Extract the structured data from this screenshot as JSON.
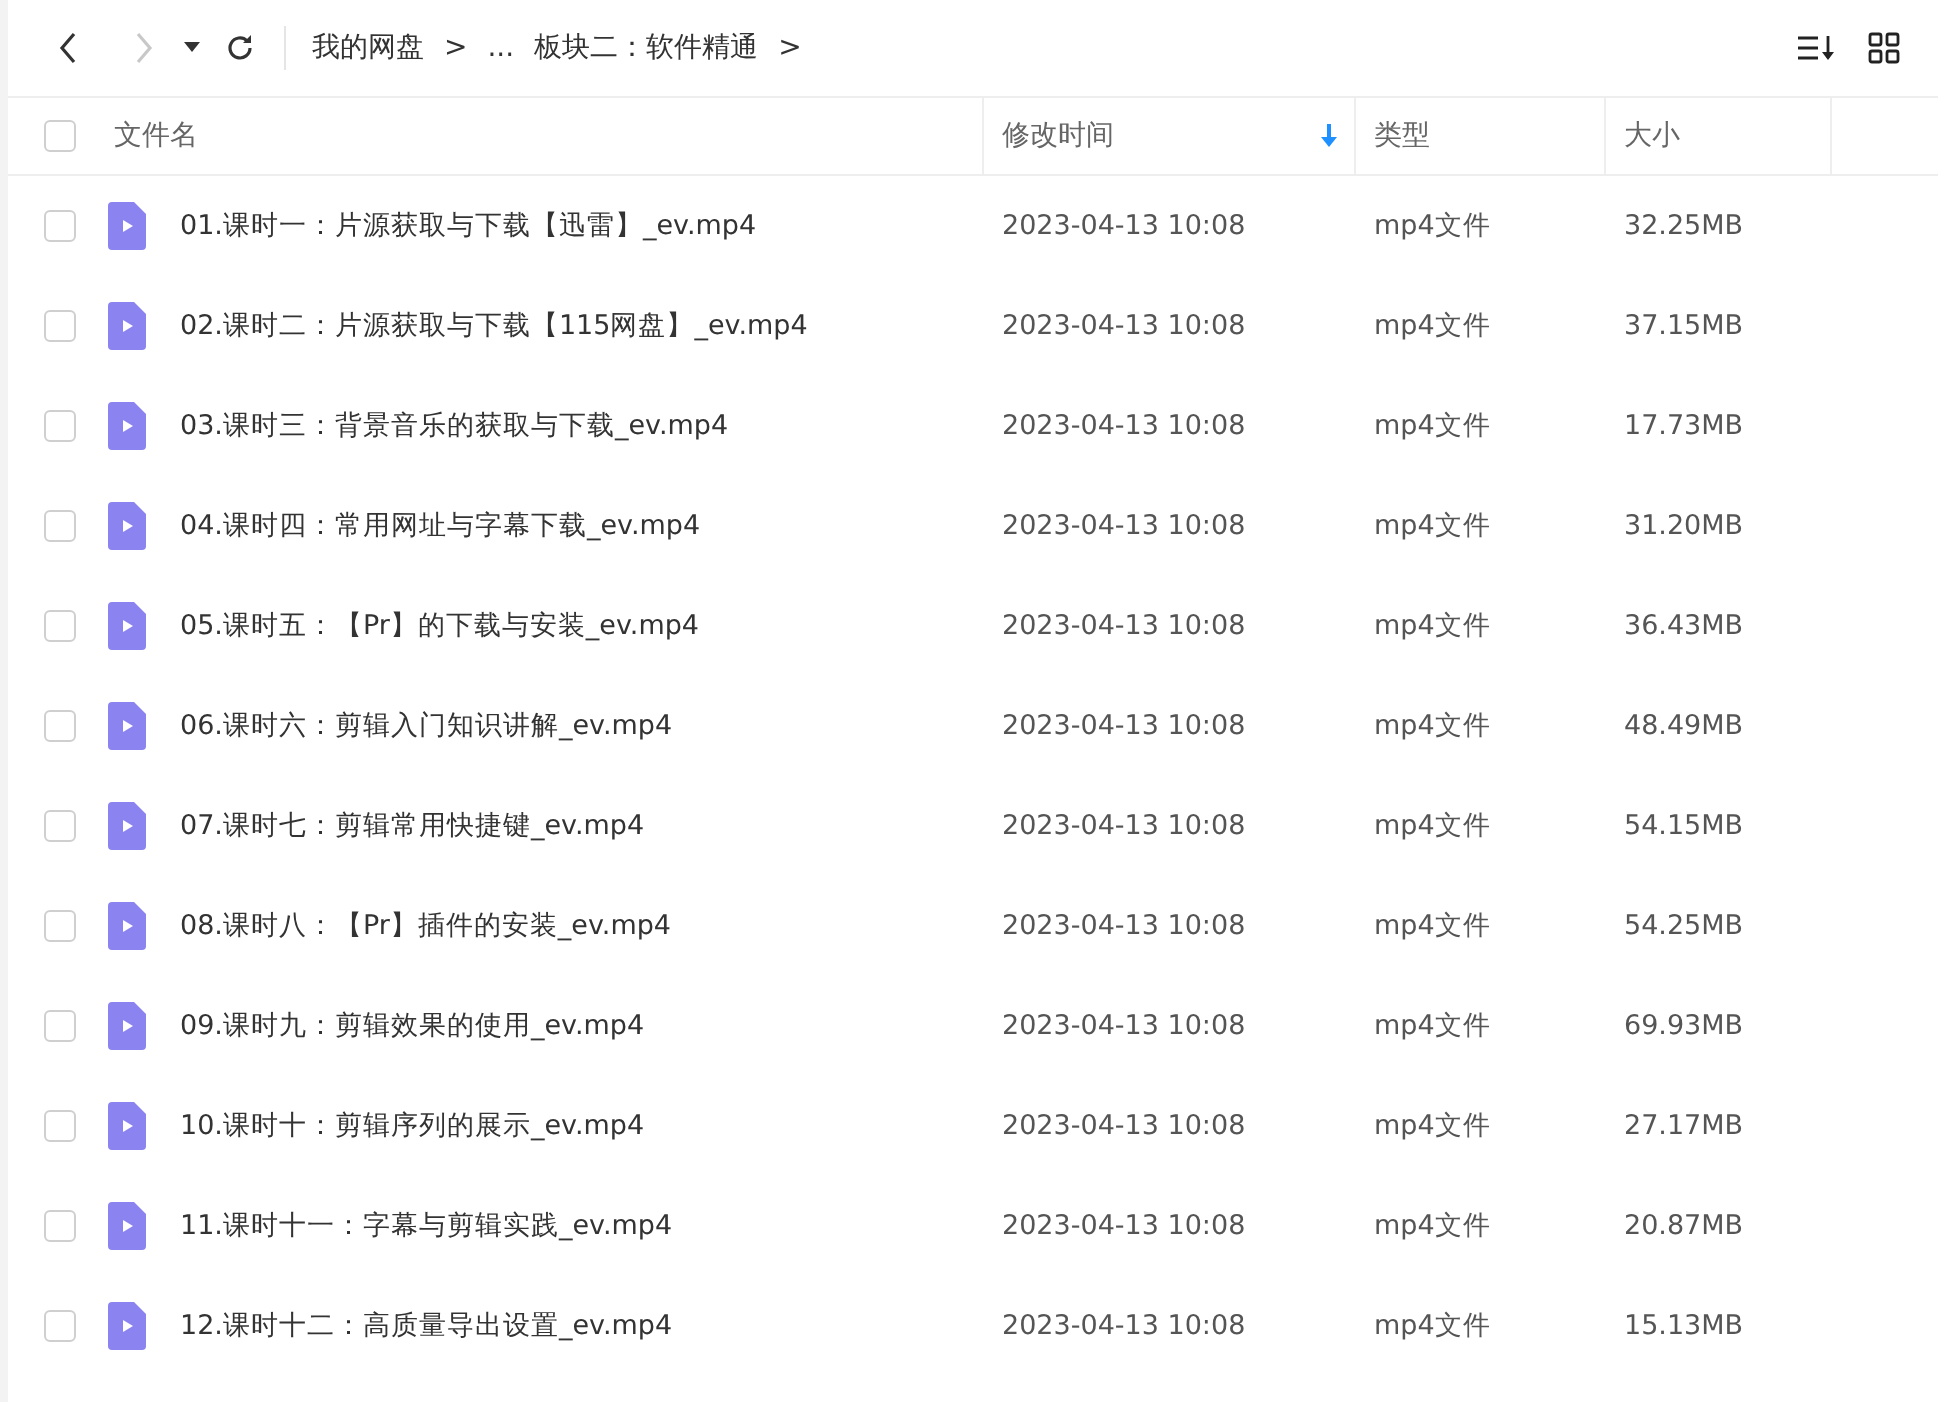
{
  "toolbar": {
    "forward_disabled": true,
    "breadcrumb": [
      {
        "label": "我的网盘",
        "separator": ">"
      },
      {
        "label": "..."
      },
      {
        "label": "板块二：软件精通",
        "separator": ">"
      }
    ]
  },
  "table": {
    "select_all": {
      "checked": false
    },
    "columns": [
      {
        "label": "文件名",
        "sorted": false
      },
      {
        "label": "修改时间",
        "sorted": true
      },
      {
        "label": "类型",
        "sorted": false
      },
      {
        "label": "大小",
        "sorted": false
      }
    ],
    "rows": [
      {
        "checked": false,
        "name": "01.课时一：片源获取与下载【迅雷】_ev.mp4",
        "modified": "2023-04-13 10:08",
        "type": "mp4文件",
        "size": "32.25MB"
      },
      {
        "checked": false,
        "name": "02.课时二：片源获取与下载【115网盘】_ev.mp4",
        "modified": "2023-04-13 10:08",
        "type": "mp4文件",
        "size": "37.15MB"
      },
      {
        "checked": false,
        "name": "03.课时三：背景音乐的获取与下载_ev.mp4",
        "modified": "2023-04-13 10:08",
        "type": "mp4文件",
        "size": "17.73MB"
      },
      {
        "checked": false,
        "name": "04.课时四：常用网址与字幕下载_ev.mp4",
        "modified": "2023-04-13 10:08",
        "type": "mp4文件",
        "size": "31.20MB"
      },
      {
        "checked": false,
        "name": "05.课时五：【Pr】的下载与安装_ev.mp4",
        "modified": "2023-04-13 10:08",
        "type": "mp4文件",
        "size": "36.43MB"
      },
      {
        "checked": false,
        "name": "06.课时六：剪辑入门知识讲解_ev.mp4",
        "modified": "2023-04-13 10:08",
        "type": "mp4文件",
        "size": "48.49MB"
      },
      {
        "checked": false,
        "name": "07.课时七：剪辑常用快捷键_ev.mp4",
        "modified": "2023-04-13 10:08",
        "type": "mp4文件",
        "size": "54.15MB"
      },
      {
        "checked": false,
        "name": "08.课时八：【Pr】插件的安装_ev.mp4",
        "modified": "2023-04-13 10:08",
        "type": "mp4文件",
        "size": "54.25MB"
      },
      {
        "checked": false,
        "name": "09.课时九：剪辑效果的使用_ev.mp4",
        "modified": "2023-04-13 10:08",
        "type": "mp4文件",
        "size": "69.93MB"
      },
      {
        "checked": false,
        "name": "10.课时十：剪辑序列的展示_ev.mp4",
        "modified": "2023-04-13 10:08",
        "type": "mp4文件",
        "size": "27.17MB"
      },
      {
        "checked": false,
        "name": "11.课时十一：字幕与剪辑实践_ev.mp4",
        "modified": "2023-04-13 10:08",
        "type": "mp4文件",
        "size": "20.87MB"
      },
      {
        "checked": false,
        "name": "12.课时十二：高质量导出设置_ev.mp4",
        "modified": "2023-04-13 10:08",
        "type": "mp4文件",
        "size": "15.13MB"
      }
    ]
  }
}
